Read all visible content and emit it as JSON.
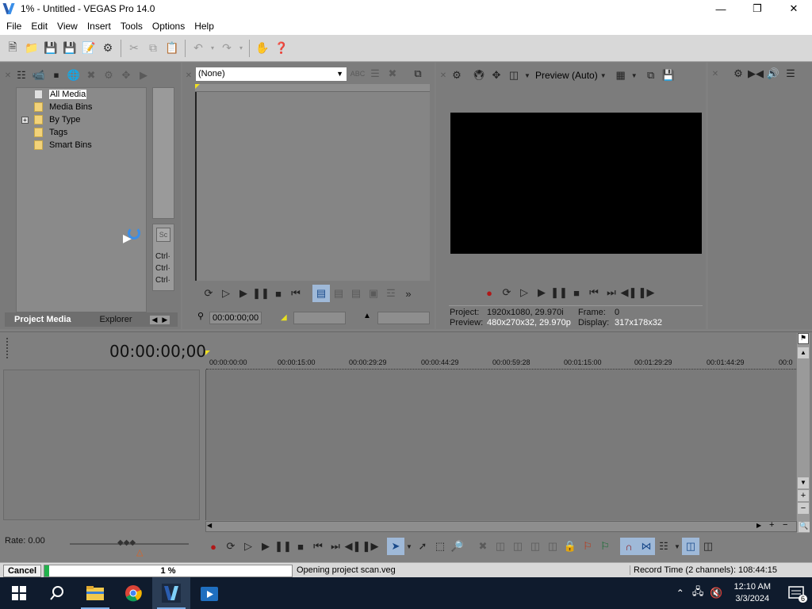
{
  "window": {
    "title": "1% - Untitled - VEGAS Pro 14.0"
  },
  "menu": [
    "File",
    "Edit",
    "View",
    "Insert",
    "Tools",
    "Options",
    "Help"
  ],
  "project_media": {
    "tree": [
      "All Media",
      "Media Bins",
      "By Type",
      "Tags",
      "Smart Bins"
    ],
    "ctrl_labels": [
      "Ctrl·",
      "Ctrl·",
      "Ctrl·"
    ],
    "tabs": [
      "Project Media",
      "Explorer"
    ]
  },
  "trimmer": {
    "selector_value": "(None)",
    "timecode": "00:00:00;00"
  },
  "preview": {
    "mode": "Preview (Auto)",
    "project_label": "Project:",
    "project_value": "1920x1080, 29.970i",
    "frame_label": "Frame:",
    "frame_value": "0",
    "preview_label": "Preview:",
    "preview_value": "480x270x32, 29.970p",
    "display_label": "Display:",
    "display_value": "317x178x32"
  },
  "timeline": {
    "timecode": "00:00:00;00",
    "ruler": [
      "00:00:00:00",
      "00:00:15:00",
      "00:00:29:29",
      "00:00:44:29",
      "00:00:59:28",
      "00:01:15:00",
      "00:01:29:29",
      "00:01:44:29",
      "00:0"
    ],
    "rate": "Rate: 0.00"
  },
  "status": {
    "cancel": "Cancel",
    "progress_text": "1 %",
    "progress_value": 0.01,
    "message": "Opening project scan.veg",
    "record_time": "Record Time (2 channels): 108:44:15"
  },
  "taskbar": {
    "time": "12:10 AM",
    "date": "3/3/2024",
    "notifications": "6"
  },
  "colors": {
    "accent": "#22b14c",
    "preview_bg": "#000000",
    "taskbar": "#0f1b2d"
  }
}
